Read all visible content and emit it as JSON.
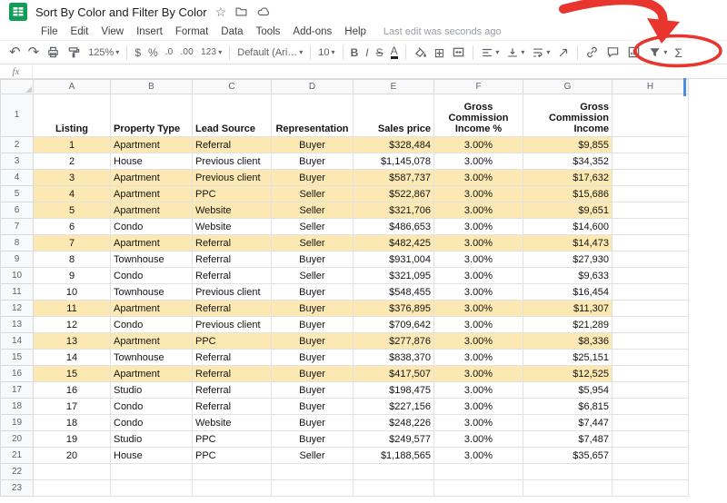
{
  "titlebar": {
    "title": "Sort By Color and Filter By Color"
  },
  "menubar": {
    "items": [
      "File",
      "Edit",
      "View",
      "Insert",
      "Format",
      "Data",
      "Tools",
      "Add-ons",
      "Help"
    ],
    "status": "Last edit was seconds ago"
  },
  "toolbar": {
    "zoom": "125%",
    "currency": "$",
    "percent": "%",
    "dec_decrease": ".0",
    "dec_increase": ".00",
    "more_formats": "123",
    "font": "Default (Ari…",
    "font_size": "10",
    "bold": "B",
    "italic": "I",
    "strikethrough": "S",
    "text_color": "A",
    "functions": "Σ"
  },
  "formula_bar": {
    "label": "fx"
  },
  "sheet": {
    "columns": [
      "A",
      "B",
      "C",
      "D",
      "E",
      "F",
      "G",
      "H"
    ],
    "header_row": [
      "Listing",
      "Property Type",
      "Lead Source",
      "Representation",
      "Sales price",
      "Gross Commission Income %",
      "Gross Commission Income"
    ],
    "highlight_color": "#fce8b2",
    "rows": [
      {
        "highlight": true,
        "cells": [
          "1",
          "Apartment",
          "Referral",
          "Buyer",
          "$328,484",
          "3.00%",
          "$9,855"
        ]
      },
      {
        "highlight": false,
        "cells": [
          "2",
          "House",
          "Previous client",
          "Buyer",
          "$1,145,078",
          "3.00%",
          "$34,352"
        ]
      },
      {
        "highlight": true,
        "cells": [
          "3",
          "Apartment",
          "Previous client",
          "Buyer",
          "$587,737",
          "3.00%",
          "$17,632"
        ]
      },
      {
        "highlight": true,
        "cells": [
          "4",
          "Apartment",
          "PPC",
          "Seller",
          "$522,867",
          "3.00%",
          "$15,686"
        ]
      },
      {
        "highlight": true,
        "cells": [
          "5",
          "Apartment",
          "Website",
          "Seller",
          "$321,706",
          "3.00%",
          "$9,651"
        ]
      },
      {
        "highlight": false,
        "cells": [
          "6",
          "Condo",
          "Website",
          "Seller",
          "$486,653",
          "3.00%",
          "$14,600"
        ]
      },
      {
        "highlight": true,
        "cells": [
          "7",
          "Apartment",
          "Referral",
          "Seller",
          "$482,425",
          "3.00%",
          "$14,473"
        ]
      },
      {
        "highlight": false,
        "cells": [
          "8",
          "Townhouse",
          "Referral",
          "Buyer",
          "$931,004",
          "3.00%",
          "$27,930"
        ]
      },
      {
        "highlight": false,
        "cells": [
          "9",
          "Condo",
          "Referral",
          "Seller",
          "$321,095",
          "3.00%",
          "$9,633"
        ]
      },
      {
        "highlight": false,
        "cells": [
          "10",
          "Townhouse",
          "Previous client",
          "Buyer",
          "$548,455",
          "3.00%",
          "$16,454"
        ]
      },
      {
        "highlight": true,
        "cells": [
          "11",
          "Apartment",
          "Referral",
          "Buyer",
          "$376,895",
          "3.00%",
          "$11,307"
        ]
      },
      {
        "highlight": false,
        "cells": [
          "12",
          "Condo",
          "Previous client",
          "Buyer",
          "$709,642",
          "3.00%",
          "$21,289"
        ]
      },
      {
        "highlight": true,
        "cells": [
          "13",
          "Apartment",
          "PPC",
          "Buyer",
          "$277,876",
          "3.00%",
          "$8,336"
        ]
      },
      {
        "highlight": false,
        "cells": [
          "14",
          "Townhouse",
          "Referral",
          "Buyer",
          "$838,370",
          "3.00%",
          "$25,151"
        ]
      },
      {
        "highlight": true,
        "cells": [
          "15",
          "Apartment",
          "Referral",
          "Buyer",
          "$417,507",
          "3.00%",
          "$12,525"
        ]
      },
      {
        "highlight": false,
        "cells": [
          "16",
          "Studio",
          "Referral",
          "Buyer",
          "$198,475",
          "3.00%",
          "$5,954"
        ]
      },
      {
        "highlight": false,
        "cells": [
          "17",
          "Condo",
          "Referral",
          "Buyer",
          "$227,156",
          "3.00%",
          "$6,815"
        ]
      },
      {
        "highlight": false,
        "cells": [
          "18",
          "Condo",
          "Website",
          "Buyer",
          "$248,226",
          "3.00%",
          "$7,447"
        ]
      },
      {
        "highlight": false,
        "cells": [
          "19",
          "Studio",
          "PPC",
          "Buyer",
          "$249,577",
          "3.00%",
          "$7,487"
        ]
      },
      {
        "highlight": false,
        "cells": [
          "20",
          "House",
          "PPC",
          "Seller",
          "$1,188,565",
          "3.00%",
          "$35,657"
        ]
      }
    ],
    "trailing_rows": 2
  },
  "annotation": {
    "color": "#e8352e"
  }
}
